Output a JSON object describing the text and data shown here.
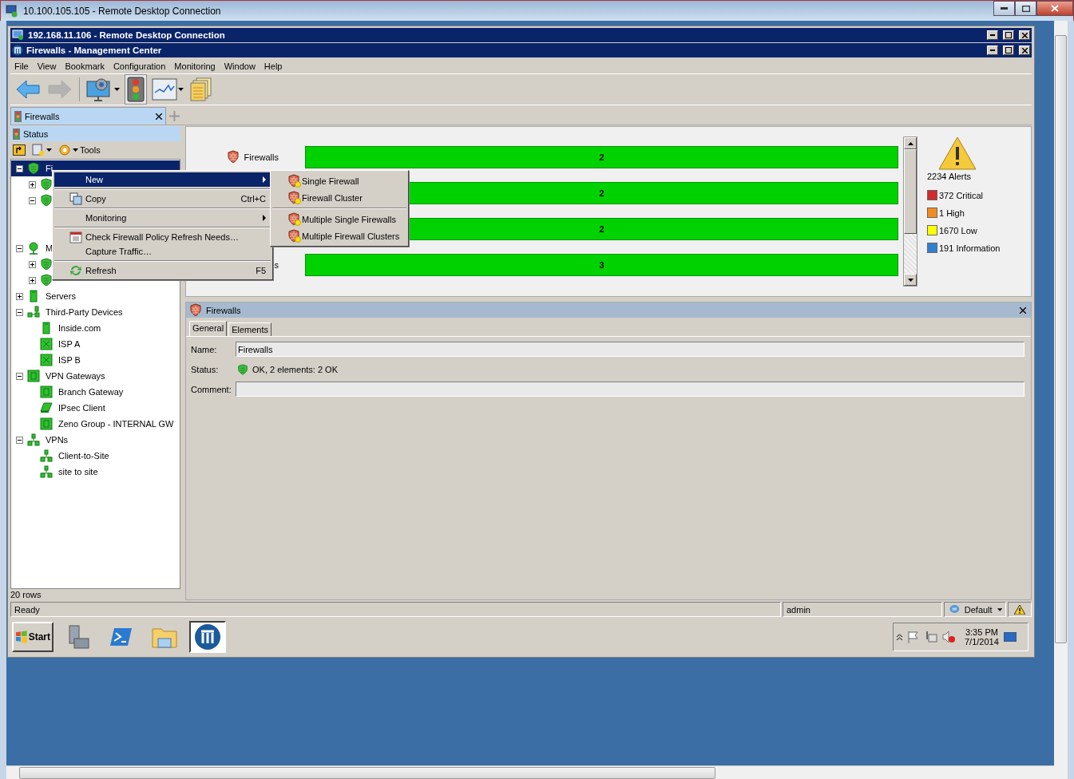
{
  "outer_window": {
    "title": "10.100.105.105 - Remote Desktop Connection"
  },
  "rdp_window": {
    "title": "192.168.11.106 - Remote Desktop Connection"
  },
  "app_window": {
    "title": "Firewalls - Management Center"
  },
  "menu_bar": [
    "File",
    "View",
    "Bookmark",
    "Configuration",
    "Monitoring",
    "Window",
    "Help"
  ],
  "toolbar": [
    {
      "kind": "back",
      "disabled": false,
      "dropdown": false
    },
    {
      "kind": "forward",
      "disabled": true,
      "dropdown": false
    },
    {
      "kind": "monitor",
      "disabled": false,
      "dropdown": true
    },
    {
      "kind": "traffic",
      "disabled": false,
      "dropdown": false
    },
    {
      "kind": "chart",
      "disabled": false,
      "dropdown": true
    },
    {
      "kind": "documents",
      "disabled": false,
      "dropdown": false
    }
  ],
  "tabs": [
    {
      "label": "Firewalls",
      "selected": true
    }
  ],
  "left_panel": {
    "header": "Status",
    "tools_label": "Tools",
    "footer": "20 rows",
    "tree": [
      {
        "kind": "shield",
        "label": "Fi",
        "expanded": true,
        "selected": true,
        "children": [
          {
            "kind": "shield",
            "expanded": false,
            "selected": false
          },
          {
            "kind": "shield",
            "expanded": true,
            "selected": false,
            "children": [
              {
                "selected": false
              },
              {
                "selected": false
              }
            ]
          }
        ]
      },
      {
        "kind": "location",
        "label": "M",
        "expanded": true,
        "selected": false,
        "children": [
          {
            "kind": "shield",
            "expanded": false,
            "selected": false
          },
          {
            "kind": "shield",
            "expanded": false,
            "selected": false
          }
        ]
      },
      {
        "kind": "server",
        "label": "Servers",
        "expanded": false,
        "selected": false
      },
      {
        "kind": "devices",
        "label": "Third-Party Devices",
        "expanded": true,
        "selected": false,
        "children": [
          {
            "kind": "server",
            "label": "Inside.com",
            "selected": false
          },
          {
            "kind": "router",
            "label": "ISP A",
            "selected": false
          },
          {
            "kind": "router",
            "label": "ISP B",
            "selected": false
          }
        ]
      },
      {
        "kind": "gateway",
        "label": "VPN Gateways",
        "expanded": true,
        "selected": false,
        "children": [
          {
            "kind": "gateway",
            "label": "Branch Gateway",
            "selected": false
          },
          {
            "kind": "laptop",
            "label": "IPsec Client",
            "selected": false
          },
          {
            "kind": "gateway",
            "label": "Zeno Group -  INTERNAL GW",
            "selected": false
          }
        ]
      },
      {
        "kind": "vpn",
        "label": "VPNs",
        "expanded": true,
        "selected": false,
        "children": [
          {
            "kind": "vpn",
            "label": "Client-to-Site",
            "selected": false
          },
          {
            "kind": "vpn",
            "label": "site to site",
            "selected": false
          }
        ]
      }
    ]
  },
  "status_overview": {
    "rows": [
      {
        "label": "Firewalls",
        "count": "2"
      },
      {
        "count": "2"
      },
      {
        "count": "2"
      },
      {
        "label": "s",
        "count": "3"
      }
    ],
    "alerts": {
      "total": "2234 Alerts",
      "levels": [
        {
          "label": "372 Critical",
          "color": "#d42a2a"
        },
        {
          "label": "1 High",
          "color": "#f28c1e"
        },
        {
          "label": "1670 Low",
          "color": "#ffff00"
        },
        {
          "label": "191 Information",
          "color": "#2f7fcf"
        }
      ]
    }
  },
  "detail_panel": {
    "title": "Firewalls",
    "tabs": [
      {
        "label": "General",
        "selected": true
      },
      {
        "label": "Elements",
        "selected": false
      }
    ],
    "fields": [
      {
        "kind": "input",
        "label": "Name:",
        "value": "Firewalls"
      },
      {
        "kind": "status",
        "label": "Status:",
        "value": "OK, 2 elements: 2 OK"
      },
      {
        "kind": "input",
        "label": "Comment:"
      }
    ]
  },
  "context_menu": {
    "items": [
      {
        "kind": "item",
        "label": "New",
        "submenu": true,
        "selected": true
      },
      {
        "kind": "separator"
      },
      {
        "kind": "item",
        "label": "Copy",
        "shortcut": "Ctrl+C",
        "submenu": false,
        "selected": false
      },
      {
        "kind": "separator"
      },
      {
        "kind": "item",
        "label": "Monitoring",
        "submenu": true,
        "selected": false
      },
      {
        "kind": "separator"
      },
      {
        "kind": "item",
        "label": "Check Firewall Policy Refresh Needs…",
        "submenu": false,
        "selected": false
      },
      {
        "kind": "item",
        "label": "Capture Traffic…",
        "submenu": false,
        "selected": false
      },
      {
        "kind": "separator"
      },
      {
        "kind": "item",
        "label": "Refresh",
        "shortcut": "F5",
        "submenu": false,
        "selected": false
      }
    ]
  },
  "submenu": {
    "items": [
      {
        "kind": "item",
        "label": "Single Firewall"
      },
      {
        "kind": "item",
        "label": "Firewall Cluster"
      },
      {
        "kind": "separator"
      },
      {
        "kind": "item",
        "label": "Multiple Single Firewalls"
      },
      {
        "kind": "item",
        "label": "Multiple Firewall Clusters"
      }
    ]
  },
  "status_bar": {
    "message": "Ready",
    "user": "admin",
    "profile": "Default"
  },
  "taskbar": {
    "start": "Start",
    "apps": [
      {
        "kind": "server",
        "selected": false
      },
      {
        "kind": "shell",
        "selected": false
      },
      {
        "kind": "folder",
        "selected": false
      },
      {
        "kind": "app",
        "selected": true
      }
    ],
    "time": "3:35 PM",
    "date": "7/1/2014"
  }
}
